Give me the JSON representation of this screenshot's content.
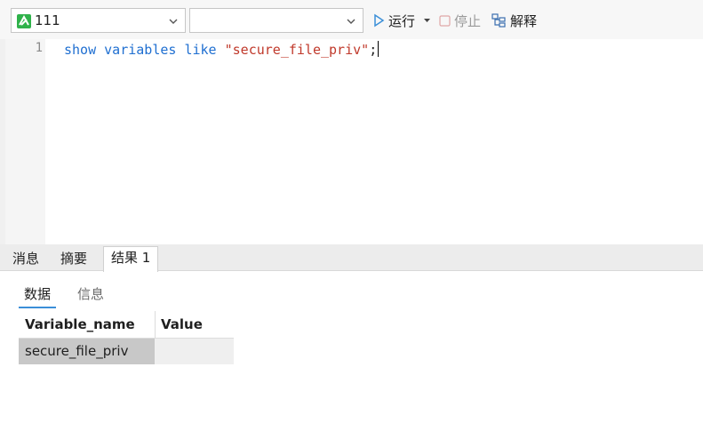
{
  "toolbar": {
    "connection": {
      "name": "111",
      "icon": "db-connection-icon"
    },
    "database": {
      "value": ""
    },
    "run_label": "运行",
    "stop_label": "停止",
    "explain_label": "解释",
    "colors": {
      "run_icon": "#3b8fd8",
      "conn_icon": "#2fb24a"
    }
  },
  "editor": {
    "line_number": "1",
    "code": {
      "kw1": "show",
      "kw2": "variables",
      "kw3": "like",
      "string": "\"secure_file_priv\"",
      "terminator": ";"
    }
  },
  "result_tabs": [
    {
      "label": "消息"
    },
    {
      "label": "摘要"
    },
    {
      "label": "结果 1",
      "active": true
    }
  ],
  "sub_tabs": [
    {
      "label": "数据",
      "active": true
    },
    {
      "label": "信息"
    }
  ],
  "grid": {
    "columns": [
      "Variable_name",
      "Value"
    ],
    "rows": [
      [
        "secure_file_priv",
        ""
      ]
    ]
  }
}
